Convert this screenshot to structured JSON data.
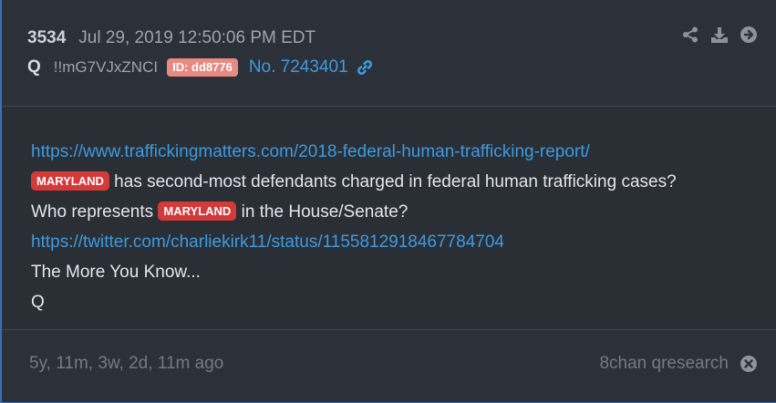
{
  "post": {
    "number": "3534",
    "date": "Jul 29, 2019 12:50:06 PM EDT",
    "author": "Q",
    "tripcode": "!!mG7VJxZNCI",
    "id_badge": "ID: dd8776",
    "post_no": "No. 7243401"
  },
  "icons": {
    "share": "share-icon",
    "download": "download-icon",
    "go": "arrow-right-circle-icon",
    "link": "link-icon",
    "close": "close-circle-icon"
  },
  "body": {
    "link1": "https://www.traffickingmatters.com/2018-federal-human-trafficking-report/",
    "tag": "MARYLAND",
    "line2_rest": " has second-most defendants charged in federal human trafficking cases?",
    "line3_pre": "Who represents ",
    "line3_post": " in the House/Senate?",
    "link2": "https://twitter.com/charliekirk11/status/1155812918467784704",
    "line5": "The More You Know...",
    "line6": "Q"
  },
  "footer": {
    "ago": "5y, 11m, 3w, 2d, 11m ago",
    "source": "8chan qresearch"
  },
  "colors": {
    "accent": "#3d9be0",
    "tag": "#d43a3a",
    "id_badge": "#e68a82"
  }
}
